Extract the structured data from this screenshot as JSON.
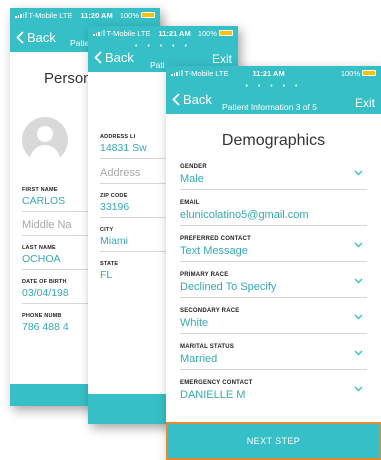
{
  "screen1": {
    "status": {
      "carrier": "T-Mobile",
      "network": "LTE",
      "time": "11:20 AM",
      "battery": "100%"
    },
    "nav": {
      "back_label": "Back",
      "title": "Patie"
    },
    "section_title": "Person",
    "fields": [
      {
        "label": "FIRST NAME",
        "value": "CARLOS"
      },
      {
        "label": "",
        "value": "Middle Na"
      },
      {
        "label": "LAST NAME",
        "value": "OCHOA"
      },
      {
        "label": "DATE OF BIRTH",
        "value": "03/04/198"
      },
      {
        "label": "PHONE NUMB",
        "value": "786 488 4"
      }
    ]
  },
  "screen2": {
    "status": {
      "carrier": "T-Mobile",
      "network": "LTE",
      "time": "11:21 AM",
      "battery": "100%"
    },
    "nav": {
      "back_label": "Back",
      "title": "Pati",
      "dots": "• • • • •",
      "exit_label": "Exit"
    },
    "fields": [
      {
        "label": "ADDRESS LI",
        "value": "14831 Sw"
      },
      {
        "label": "",
        "value": "Address"
      },
      {
        "label": "ZIP CODE",
        "value": "33196"
      },
      {
        "label": "CITY",
        "value": "Miami"
      },
      {
        "label": "STATE",
        "value": "FL"
      }
    ]
  },
  "screen3": {
    "status": {
      "carrier": "T-Mobile",
      "network": "LTE",
      "time": "11:21 AM",
      "battery": "100%"
    },
    "nav": {
      "back_label": "Back",
      "title": "Patient Information 3 of 5",
      "dots": "• • • • •",
      "exit_label": "Exit"
    },
    "section_title": "Demographics",
    "fields": [
      {
        "label": "GENDER",
        "value": "Male",
        "dropdown": true
      },
      {
        "label": "EMAIL",
        "value": "elunicolatino5@gmail.com",
        "dropdown": false
      },
      {
        "label": "PREFERRED CONTACT",
        "value": "Text Message",
        "dropdown": true
      },
      {
        "label": "PRIMARY RACE",
        "value": "Declined To Specify",
        "dropdown": true
      },
      {
        "label": "SECONDARY RACE",
        "value": "White",
        "dropdown": true
      },
      {
        "label": "MARITAL STATUS",
        "value": "Married",
        "dropdown": true
      },
      {
        "label": "EMERGENCY CONTACT",
        "value": "DANIELLE M",
        "dropdown": true
      }
    ],
    "next_button": "NEXT STEP"
  },
  "colors": {
    "accent": "#36bfc6",
    "value_text": "#36a9b3",
    "highlight_border": "#e88a2e",
    "battery": "#f5c400"
  },
  "icons": {
    "back": "chevron-left-icon",
    "dropdown": "chevron-down-icon",
    "signal": "signal-bars-icon",
    "battery": "battery-icon",
    "avatar": "user-silhouette-icon"
  }
}
